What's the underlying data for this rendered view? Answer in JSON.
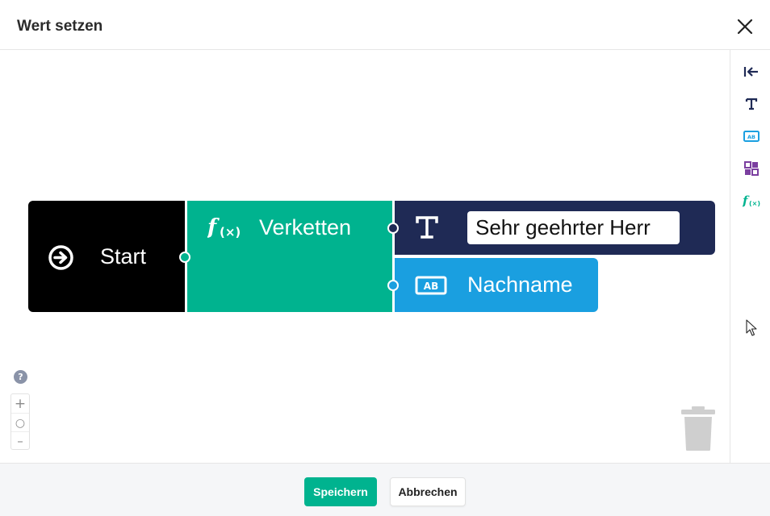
{
  "dialog": {
    "title": "Wert setzen"
  },
  "blocks": {
    "start_label": "Start",
    "concat_label": "Verketten",
    "text_value": "Sehr geehrter Herr",
    "variable_label": "Nachname"
  },
  "toolbox": {
    "items": [
      "collapse-icon",
      "text-icon",
      "variable-icon",
      "list-icon",
      "function-icon"
    ]
  },
  "zoom": {
    "help": "?",
    "in": "+",
    "reset": "○",
    "out": "–"
  },
  "footer": {
    "save_label": "Speichern",
    "cancel_label": "Abbrechen"
  },
  "colors": {
    "start": "#000000",
    "concat": "#00b38f",
    "text": "#1f2a55",
    "variable": "#1a9fe0",
    "primary": "#00b38f"
  }
}
